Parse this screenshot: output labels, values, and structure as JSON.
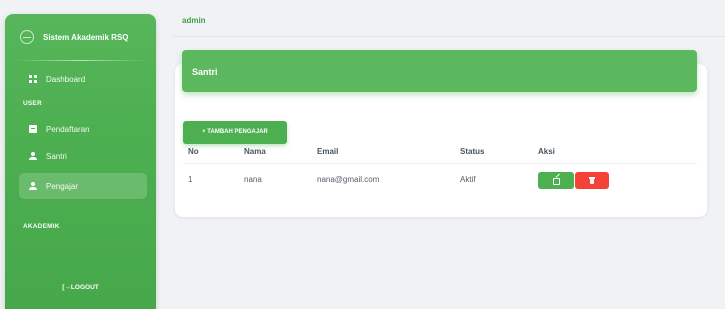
{
  "sidebar": {
    "brand": "Sistem Akademik RSQ",
    "items": [
      {
        "label": "Dashboard",
        "icon": "dashboard-icon"
      },
      {
        "label": "Pendaftaran",
        "icon": "document-icon"
      },
      {
        "label": "Santri",
        "icon": "user-icon"
      },
      {
        "label": "Pengajar",
        "icon": "user-icon",
        "active": true
      }
    ],
    "section_user": "USER",
    "section_akademik": "AKADEMIK",
    "logout": "[→LOGOUT"
  },
  "topbar": {
    "user": "admin"
  },
  "card": {
    "title": "Santri",
    "add_button": "+ TAMBAH PENGAJAR",
    "columns": [
      "No",
      "Nama",
      "Email",
      "Status",
      "Aksi"
    ],
    "rows": [
      {
        "no": "1",
        "nama": "nana",
        "email": "nana@gmail.com",
        "status": "Aktif"
      }
    ]
  },
  "colors": {
    "primary": "#4caf50",
    "danger": "#f44336",
    "accent_text": "#43a047"
  }
}
